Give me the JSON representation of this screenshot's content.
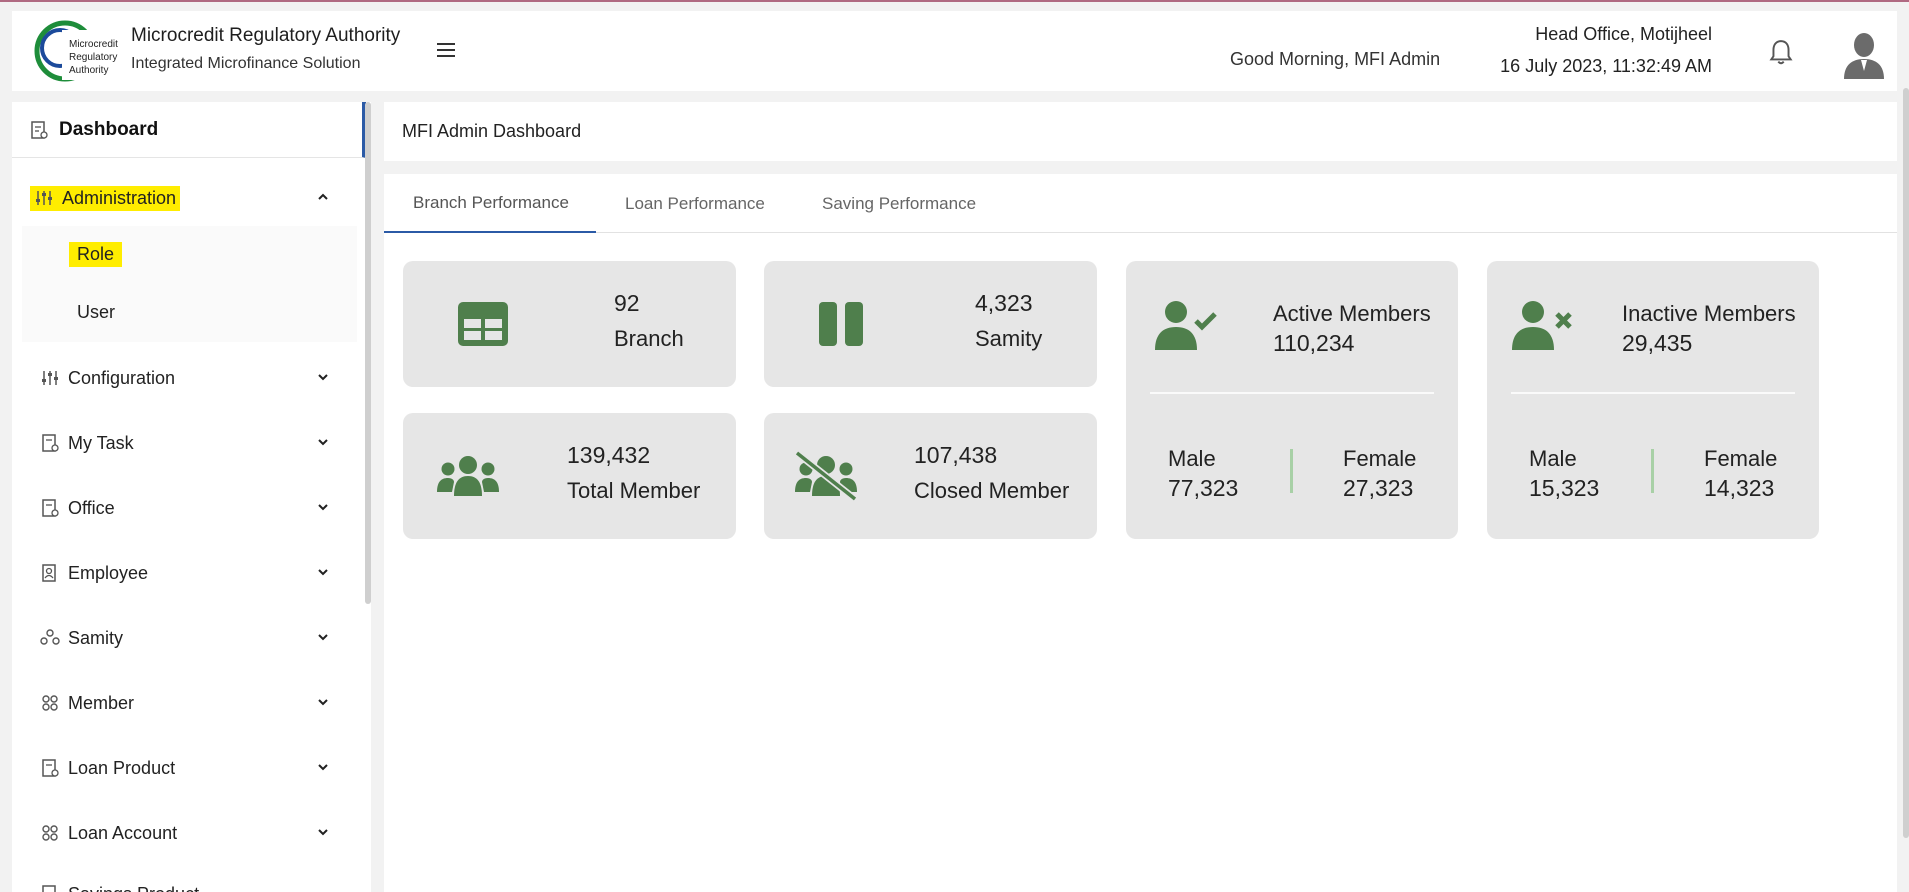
{
  "header": {
    "org_name": "Microcredit Regulatory Authority",
    "org_sub": "Integrated Microfinance Solution",
    "logo_text": "Microcredit Regulatory Authority",
    "greeting": "Good Morning, MFI Admin",
    "office": "Head Office, Motijheel",
    "datetime": "16 July 2023, 11:32:49 AM"
  },
  "sidebar": {
    "dashboard": "Dashboard",
    "administration": "Administration",
    "role": "Role",
    "user": "User",
    "items": [
      "Configuration",
      "My Task",
      "Office",
      "Employee",
      "Samity",
      "Member",
      "Loan Product",
      "Loan Account",
      "Savings Product"
    ]
  },
  "main": {
    "breadcrumb": "MFI Admin Dashboard",
    "tabs": [
      "Branch Performance",
      "Loan Performance",
      "Saving Performance"
    ],
    "cards": {
      "branch": {
        "value": "92",
        "label": "Branch"
      },
      "samity": {
        "value": "4,323",
        "label": "Samity"
      },
      "total_member": {
        "value": "139,432",
        "label": "Total Member"
      },
      "closed_member": {
        "value": "107,438",
        "label": "Closed Member"
      },
      "active": {
        "label": "Active Members",
        "value": "110,234",
        "male_label": "Male",
        "male": "77,323",
        "female_label": "Female",
        "female": "27,323"
      },
      "inactive": {
        "label": "Inactive Members",
        "value": "29,435",
        "male_label": "Male",
        "male": "15,323",
        "female_label": "Female",
        "female": "14,323"
      }
    }
  },
  "colors": {
    "accent": "#2b5aa6",
    "icon_green": "#4f7f4c",
    "highlight": "#ffed00",
    "card_bg": "#e6e6e6"
  }
}
